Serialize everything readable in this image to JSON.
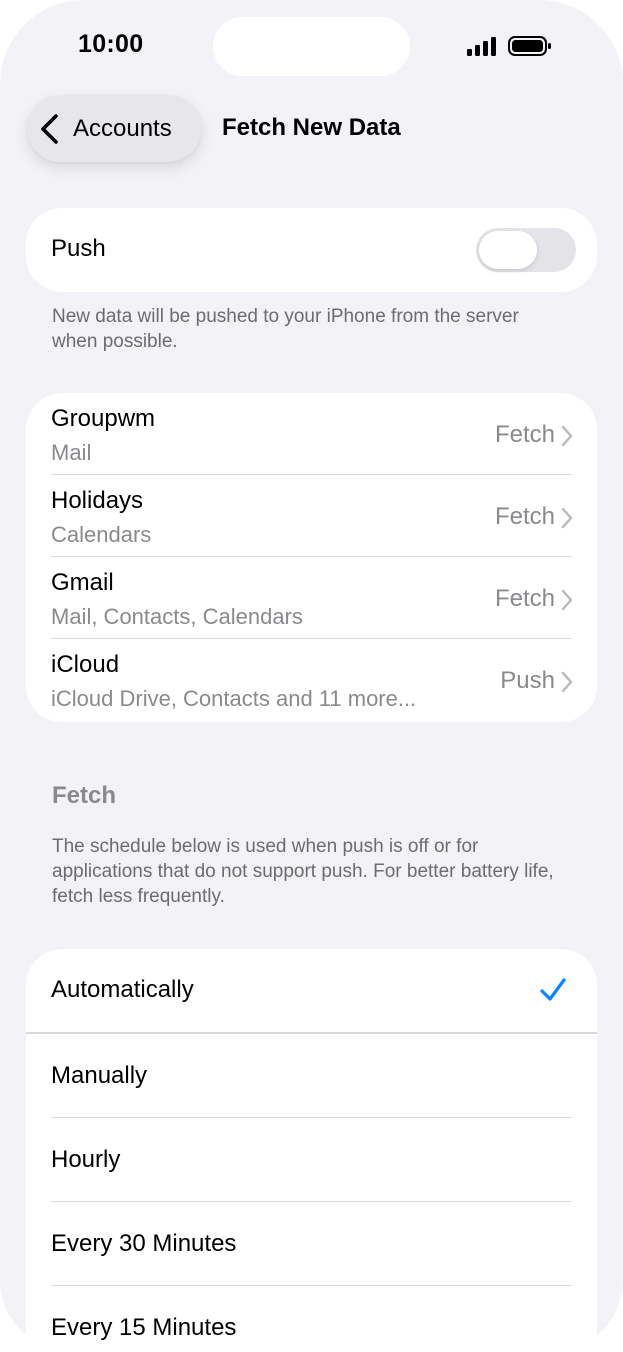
{
  "status_bar": {
    "time": "10:00",
    "signal_icon": "cellular-signal-icon",
    "battery_icon": "battery-icon"
  },
  "nav": {
    "back_label": "Accounts",
    "back_icon": "chevron-left-icon",
    "title": "Fetch New Data"
  },
  "push": {
    "label": "Push",
    "toggle_on": false,
    "note": "New data will be pushed to your iPhone from the server when possible."
  },
  "accounts": [
    {
      "name": "Groupwm",
      "sub": "Mail",
      "value": "Fetch"
    },
    {
      "name": "Holidays",
      "sub": "Calendars",
      "value": "Fetch"
    },
    {
      "name": "Gmail",
      "sub": "Mail, Contacts, Calendars",
      "value": "Fetch"
    },
    {
      "name": "iCloud",
      "sub": "iCloud Drive, Contacts and 11 more...",
      "value": "Push"
    }
  ],
  "fetch": {
    "header": "Fetch",
    "note": "The schedule below is used when push is off or for applications that do not support push. For better battery life, fetch less frequently."
  },
  "schedule": {
    "selected_index": 0,
    "accent_color": "#0a84ff",
    "options": [
      "Automatically",
      "Manually",
      "Hourly",
      "Every 30 Minutes",
      "Every 15 Minutes"
    ]
  }
}
